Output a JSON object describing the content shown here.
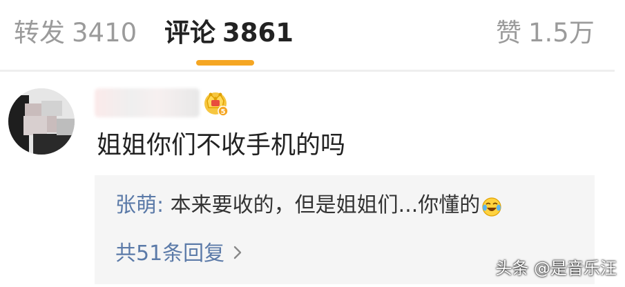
{
  "tabs": {
    "repost": {
      "label": "转发",
      "count": "3410"
    },
    "comments": {
      "label": "评论",
      "count": "3861"
    },
    "likes": {
      "label": "赞",
      "count": "1.5万"
    },
    "active": "comments",
    "indicator_color": "#f5a623"
  },
  "comment": {
    "text": "姐姐你们不收手机的吗",
    "username_blurred": true,
    "badge_icon": "crown-vip-badge-icon",
    "badge_level": "5"
  },
  "reply": {
    "author": "张萌",
    "separator": ":",
    "text": "本来要收的，但是姐姐们...你懂的",
    "emoji_icon": "laugh-cry-emoji-icon",
    "more": "共51条回复",
    "more_icon": "chevron-right-icon",
    "link_color": "#5b7aa8"
  },
  "watermark": {
    "text": "头条 @是音乐汪"
  }
}
